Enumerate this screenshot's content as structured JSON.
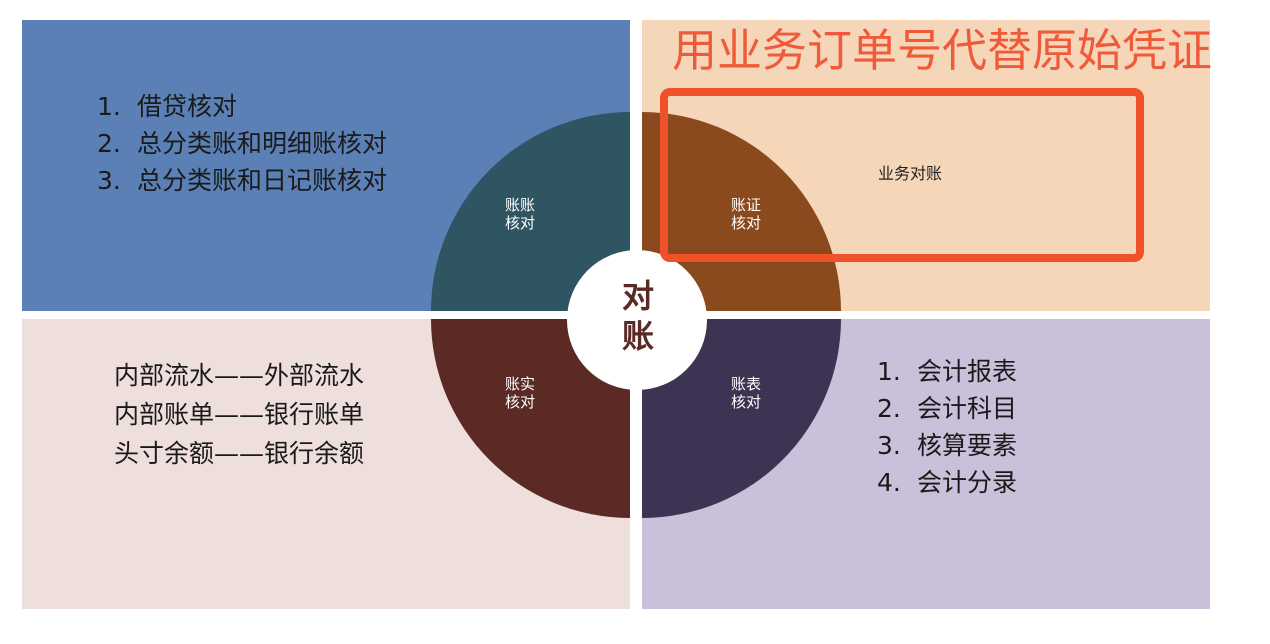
{
  "headline": "用业务订单号代替原始凭证",
  "center": {
    "line1": "对",
    "line2": "账"
  },
  "segments": {
    "top_left": {
      "line1": "账账",
      "line2": "核对"
    },
    "top_right": {
      "line1": "账证",
      "line2": "核对"
    },
    "bottom_left": {
      "line1": "账实",
      "line2": "核对"
    },
    "bottom_right": {
      "line1": "账表",
      "line2": "核对"
    }
  },
  "top_left_list": [
    {
      "num": "1.",
      "text": "借贷核对"
    },
    {
      "num": "2.",
      "text": "总分类账和明细账核对"
    },
    {
      "num": "3.",
      "text": "总分类账和日记账核对"
    }
  ],
  "top_right_box_label": "业务对账",
  "bottom_left_pairs": [
    "内部流水——外部流水",
    "内部账单——银行账单",
    "头寸余额——银行余额"
  ],
  "bottom_right_list": [
    {
      "num": "1.",
      "text": "会计报表"
    },
    {
      "num": "2.",
      "text": "会计科目"
    },
    {
      "num": "3.",
      "text": "核算要素"
    },
    {
      "num": "4.",
      "text": "会计分录"
    }
  ],
  "colors": {
    "top_left_bg": "#5b80b6",
    "top_right_bg": "#f6d6b9",
    "bottom_left_bg": "#efdfdc",
    "bottom_right_bg": "#c9c0d9",
    "seg_top_left": "#2f5563",
    "seg_top_right": "#8b4a1e",
    "seg_bottom_left": "#5b2a24",
    "seg_bottom_right": "#3d3352",
    "highlight": "#ef5128"
  }
}
